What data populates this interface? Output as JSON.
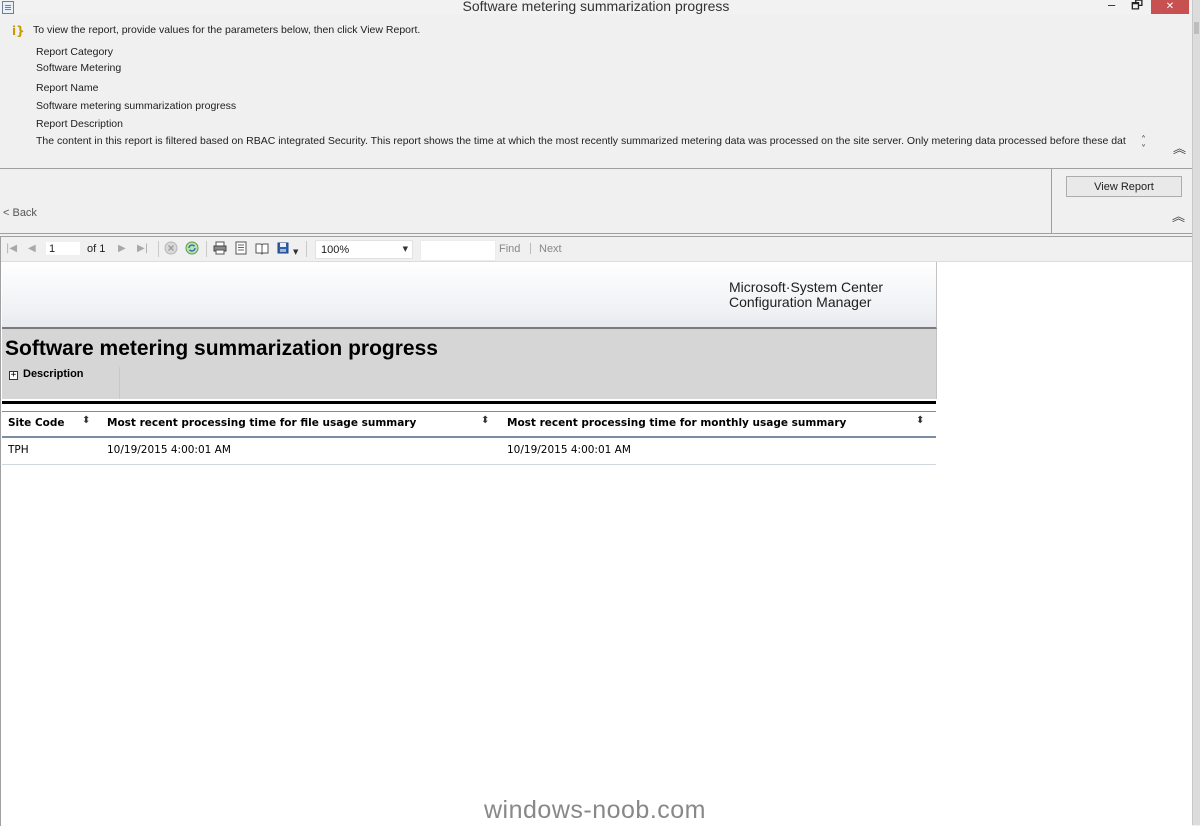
{
  "window": {
    "title": "Software metering summarization progress",
    "minimize_glyph": "–",
    "restore_glyph": "🗗",
    "close_glyph": "✕"
  },
  "params": {
    "info_text": "To view the report, provide values for the parameters below, then click View Report.",
    "category_label": "Report Category",
    "category_value": "Software Metering",
    "name_label": "Report Name",
    "name_value": "Software metering summarization progress",
    "description_label": "Report Description",
    "description_value": "The content in this report is filtered based on RBAC integrated Security. This report shows the time at which the most recently summarized metering data was processed on the site server.  Only metering data processed before these dates will be"
  },
  "actions": {
    "back_label": "< Back",
    "view_report_label": "View Report"
  },
  "toolbar": {
    "page_value": "1",
    "of_label": "of 1",
    "zoom_value": "100%",
    "find_label": "Find",
    "next_label": "Next"
  },
  "report": {
    "brand_line1": "Microsoft·System Center",
    "brand_line2": "Configuration Manager",
    "title": "Software metering summarization progress",
    "description_toggle": "Description",
    "columns": [
      "Site Code",
      "Most recent processing time for file usage summary",
      "Most recent processing time for monthly usage summary"
    ],
    "rows": [
      [
        "TPH",
        "10/19/2015 4:00:01 AM",
        "10/19/2015 4:00:01 AM"
      ]
    ]
  },
  "watermark": "windows-noob.com",
  "colors": {
    "window_bg": "#f0f0f0",
    "close_button": "#c75050",
    "header_band": "#d6d6d6",
    "table_rule": "#7b8ca3"
  }
}
